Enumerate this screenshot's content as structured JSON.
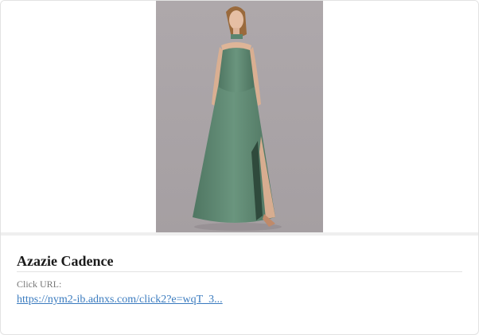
{
  "ad": {
    "image_alt": "Model wearing a sage green strapless satin gown with a high slit",
    "dress_color": "#5f8a73",
    "background_color": "#aba5a8",
    "title": "Azazie Cadence",
    "click_url_label": "Click URL:",
    "click_url_text": "https://nym2-ib.adnxs.com/click2?e=wqT_3..."
  }
}
